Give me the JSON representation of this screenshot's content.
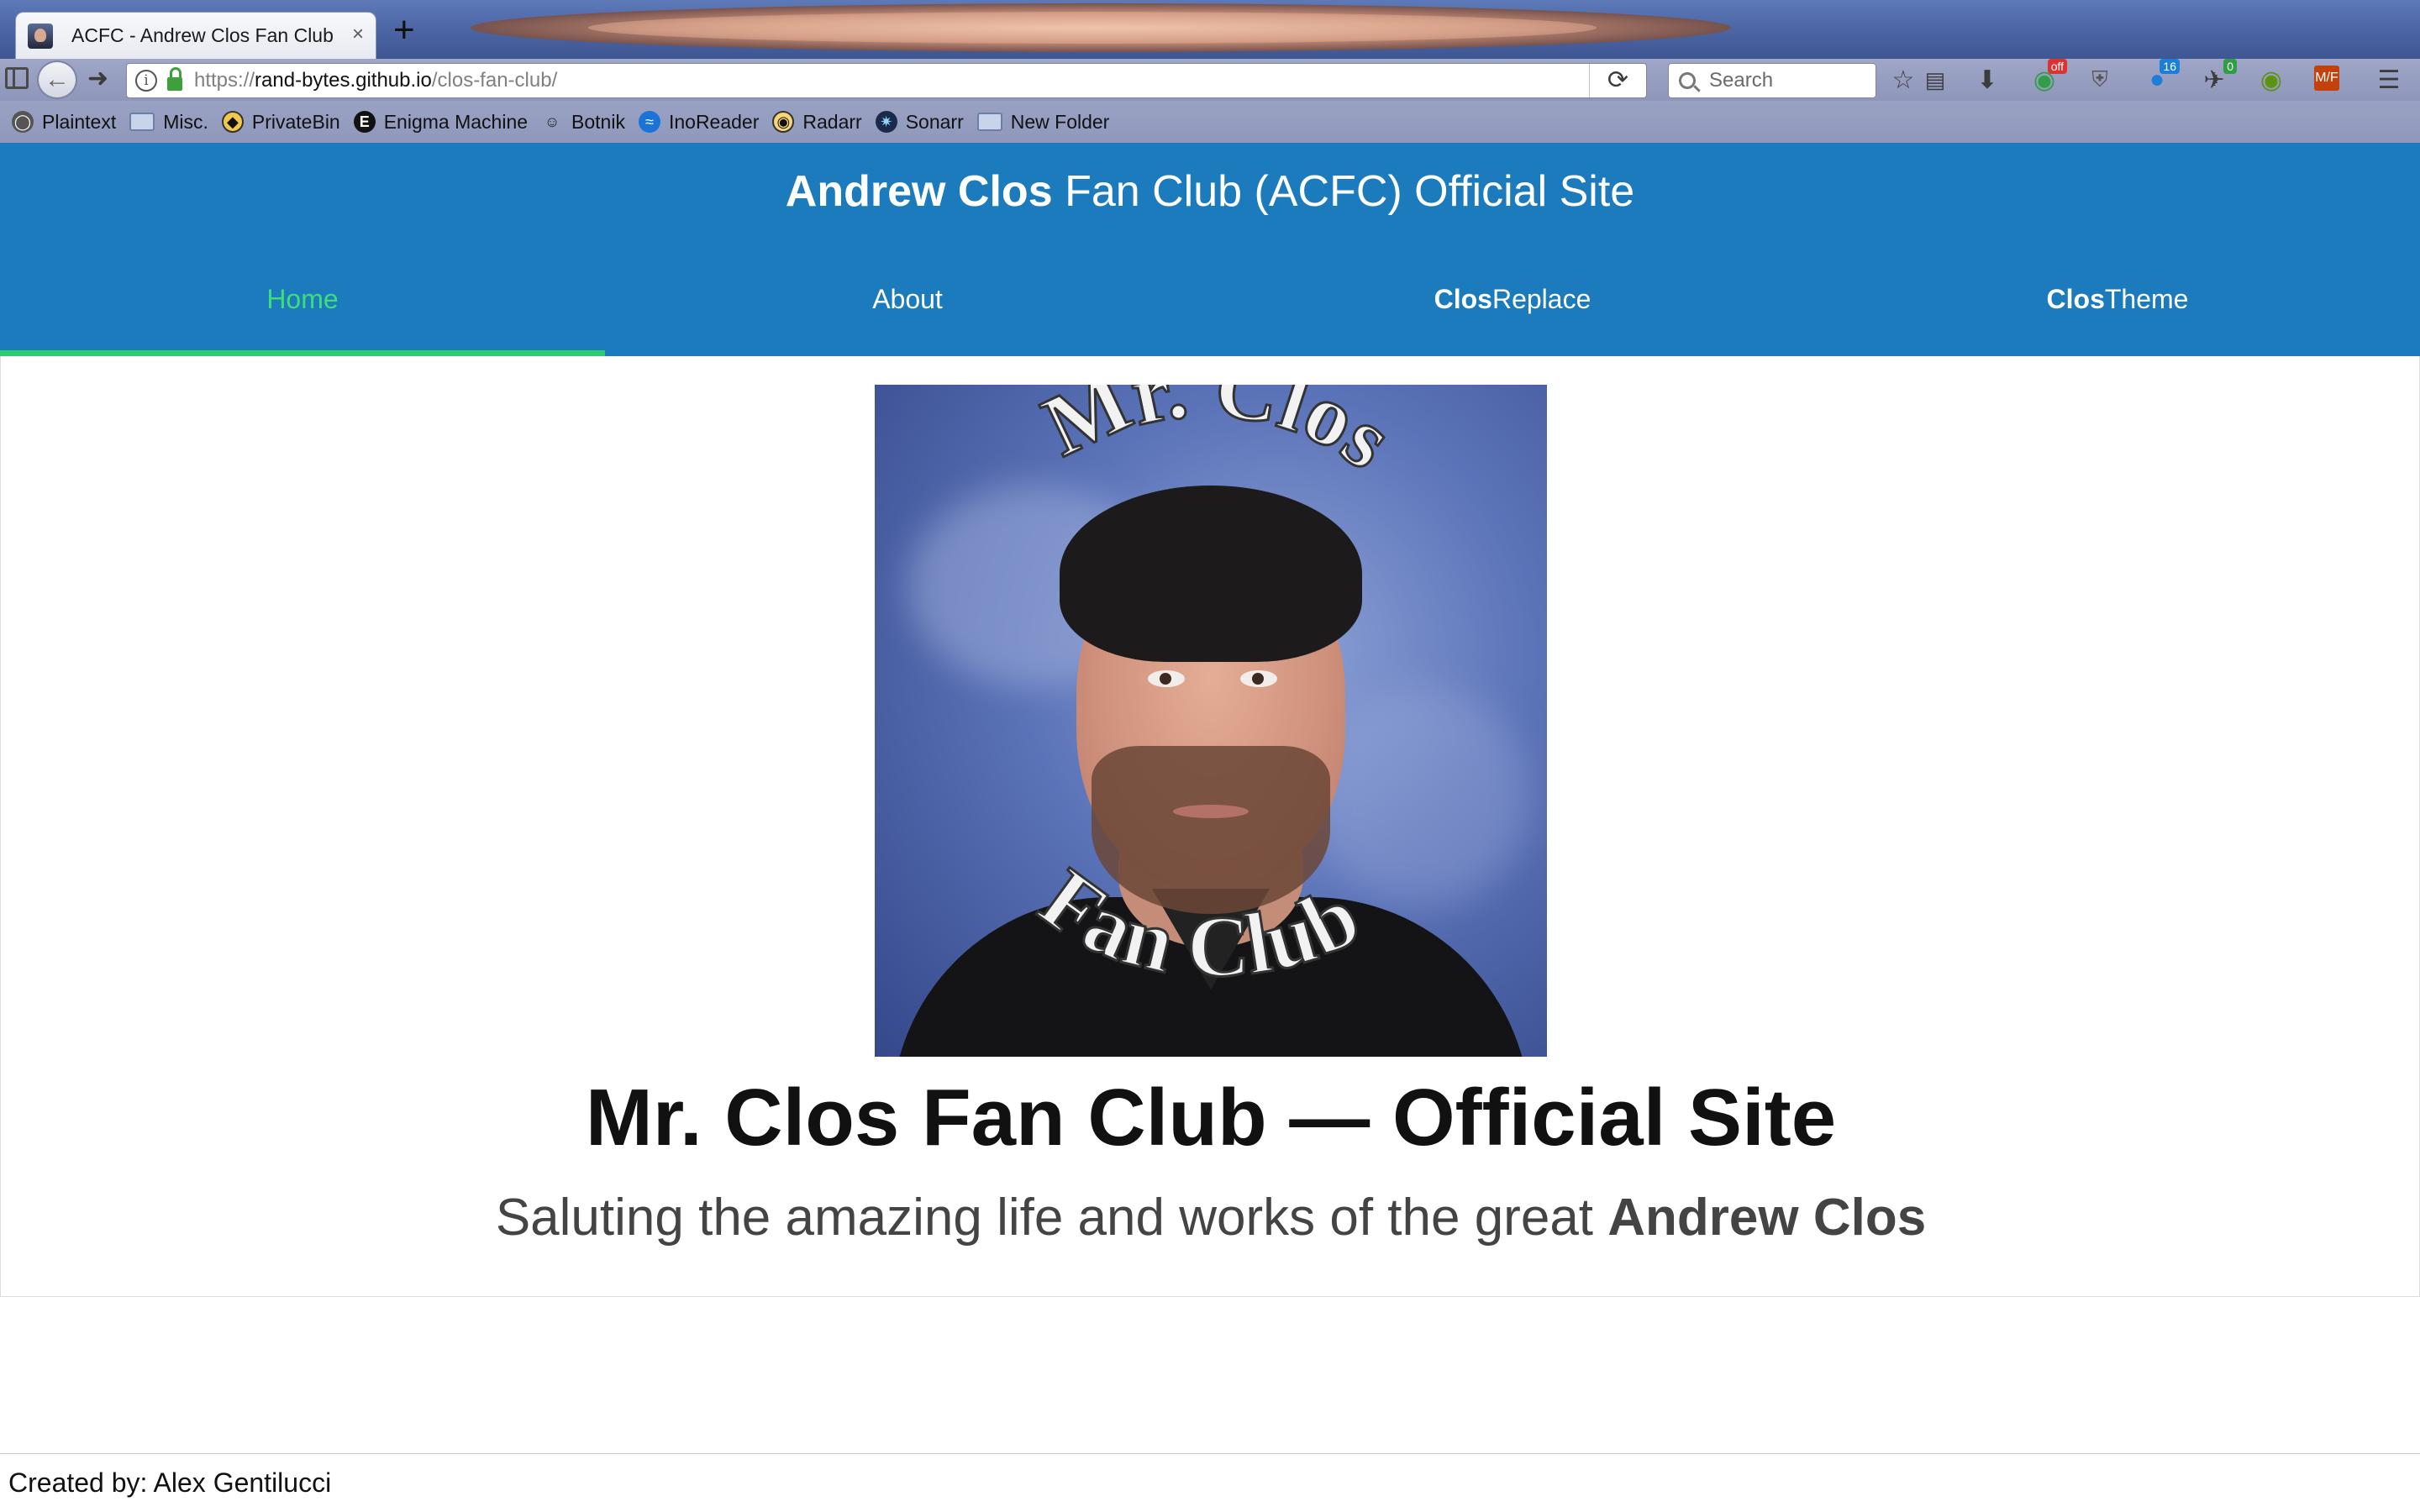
{
  "browser": {
    "tab_title": "ACFC - Andrew Clos Fan Club",
    "tab_close": "×",
    "new_tab": "+",
    "url_prefix": "https://",
    "url_host": "rand-bytes.github.io",
    "url_path": "/clos-fan-club/",
    "search_placeholder": "Search",
    "toolbar_badges": {
      "off": "off",
      "sixteen": "16",
      "zero": "0",
      "mf": "M/F"
    },
    "bookmarks": [
      {
        "label": "Plaintext",
        "icon": "globe-icon"
      },
      {
        "label": "Misc.",
        "icon": "folder-icon"
      },
      {
        "label": "PrivateBin",
        "icon": "privatebin-icon"
      },
      {
        "label": "Enigma Machine",
        "icon": "enigma-icon"
      },
      {
        "label": "Botnik",
        "icon": "botnik-icon"
      },
      {
        "label": "InoReader",
        "icon": "inoreader-icon"
      },
      {
        "label": "Radarr",
        "icon": "radarr-icon"
      },
      {
        "label": "Sonarr",
        "icon": "sonarr-icon"
      },
      {
        "label": "New Folder",
        "icon": "folder-icon"
      }
    ]
  },
  "site": {
    "title_bold": "Andrew Clos",
    "title_rest": " Fan Club (ACFC) Official Site",
    "nav": [
      {
        "bold": "",
        "label": "Home",
        "active": true
      },
      {
        "bold": "",
        "label": "About",
        "active": false
      },
      {
        "bold": "Clos",
        "label": "Replace",
        "active": false
      },
      {
        "bold": "Clos",
        "label": "Theme",
        "active": false
      }
    ],
    "colors": {
      "header_bg": "#1b7bbd",
      "active_nav": "#3fdc7a",
      "active_underline": "#2ecc71"
    },
    "photo_arc_top": "Mr. Clos",
    "photo_arc_bottom": "Fan Club",
    "heading_bold": "Mr. Clos",
    "heading_rest": " Fan Club — Official Site",
    "subtitle_rest": "Saluting the amazing life and works of the great ",
    "subtitle_bold": "Andrew Clos",
    "footer": "Created by: Alex Gentilucci"
  }
}
